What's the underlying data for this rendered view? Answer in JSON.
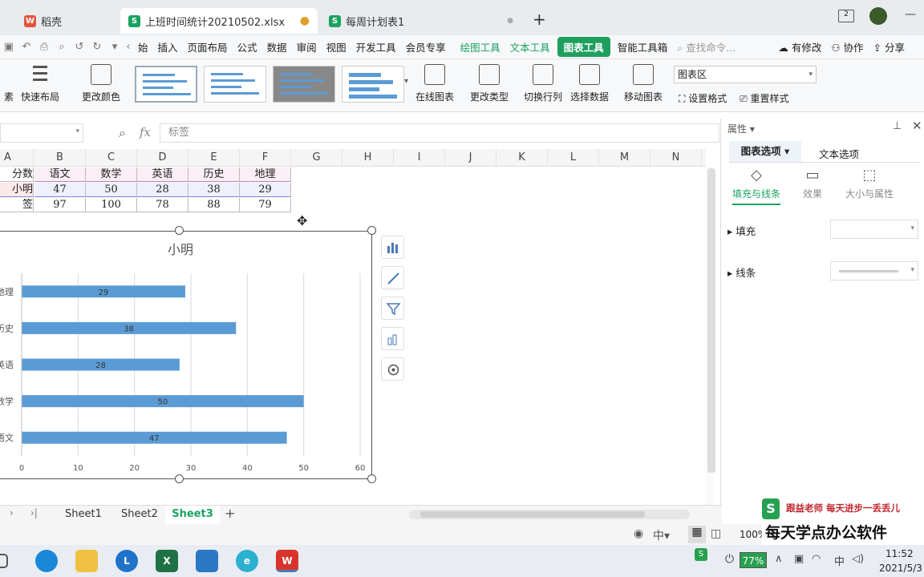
{
  "tabs": [
    {
      "label": "稻壳",
      "color": "#e5533c"
    },
    {
      "label": "上班时间统计20210502.xlsx",
      "color": "#1aa260"
    },
    {
      "label": "每周计划表1",
      "color": "#1aa260"
    }
  ],
  "menu": [
    "始",
    "插入",
    "页面布局",
    "公式",
    "数据",
    "审阅",
    "视图",
    "开发工具",
    "会员专享"
  ],
  "menu_green": [
    "绘图工具",
    "文本工具"
  ],
  "menu_active": "图表工具",
  "menu_after": "智能工具箱",
  "search_placeholder": "查找命令...",
  "menu_right": [
    "有修改",
    "协作",
    "分享"
  ],
  "ribbon": {
    "left_cut": "素",
    "quick_layout": "快速布局",
    "change_color": "更改颜色",
    "online_chart": "在线图表",
    "change_type": "更改类型",
    "switch_rowcol": "切换行列",
    "select_data": "选择数据",
    "move_chart": "移动图表",
    "chart_area": "图表区",
    "set_format": "设置格式",
    "reset_style": "重置样式"
  },
  "formula": {
    "label": "标签",
    "fx": "fx"
  },
  "columns": [
    "A",
    "B",
    "C",
    "D",
    "E",
    "F",
    "G",
    "H",
    "I",
    "J",
    "K",
    "L",
    "M",
    "N"
  ],
  "table": {
    "header": [
      "分数",
      "语文",
      "数学",
      "英语",
      "历史",
      "地理"
    ],
    "rows": [
      [
        "小明",
        "47",
        "50",
        "28",
        "38",
        "29"
      ],
      [
        "签",
        "97",
        "100",
        "78",
        "88",
        "79"
      ]
    ]
  },
  "chart_data": {
    "type": "bar",
    "orientation": "horizontal",
    "title": "小明",
    "categories": [
      "地理",
      "历史",
      "英语",
      "数学",
      "语文"
    ],
    "values": [
      29,
      38,
      28,
      50,
      47
    ],
    "xlim": [
      0,
      60
    ],
    "xticks": [
      "0",
      "10",
      "20",
      "30",
      "40",
      "50",
      "60"
    ],
    "grid": true,
    "bar_color": "#5b9bd5"
  },
  "pane": {
    "title": "属性",
    "tab1": "图表选项",
    "tab2": "文本选项",
    "sub1": "填充与线条",
    "sub2": "效果",
    "sub3": "大小与属性",
    "fill": "填充",
    "line": "线条"
  },
  "sheets": [
    "Sheet1",
    "Sheet2",
    "Sheet3"
  ],
  "active_sheet": "Sheet3",
  "status": {
    "zoom": "100%"
  },
  "watermark": {
    "line1": "跟益老师  每天进步一丢丢儿",
    "line2": "每天学点办公软件"
  },
  "taskbar": {
    "battery": "77%",
    "time": "11:52",
    "date": "2021/5/3"
  }
}
